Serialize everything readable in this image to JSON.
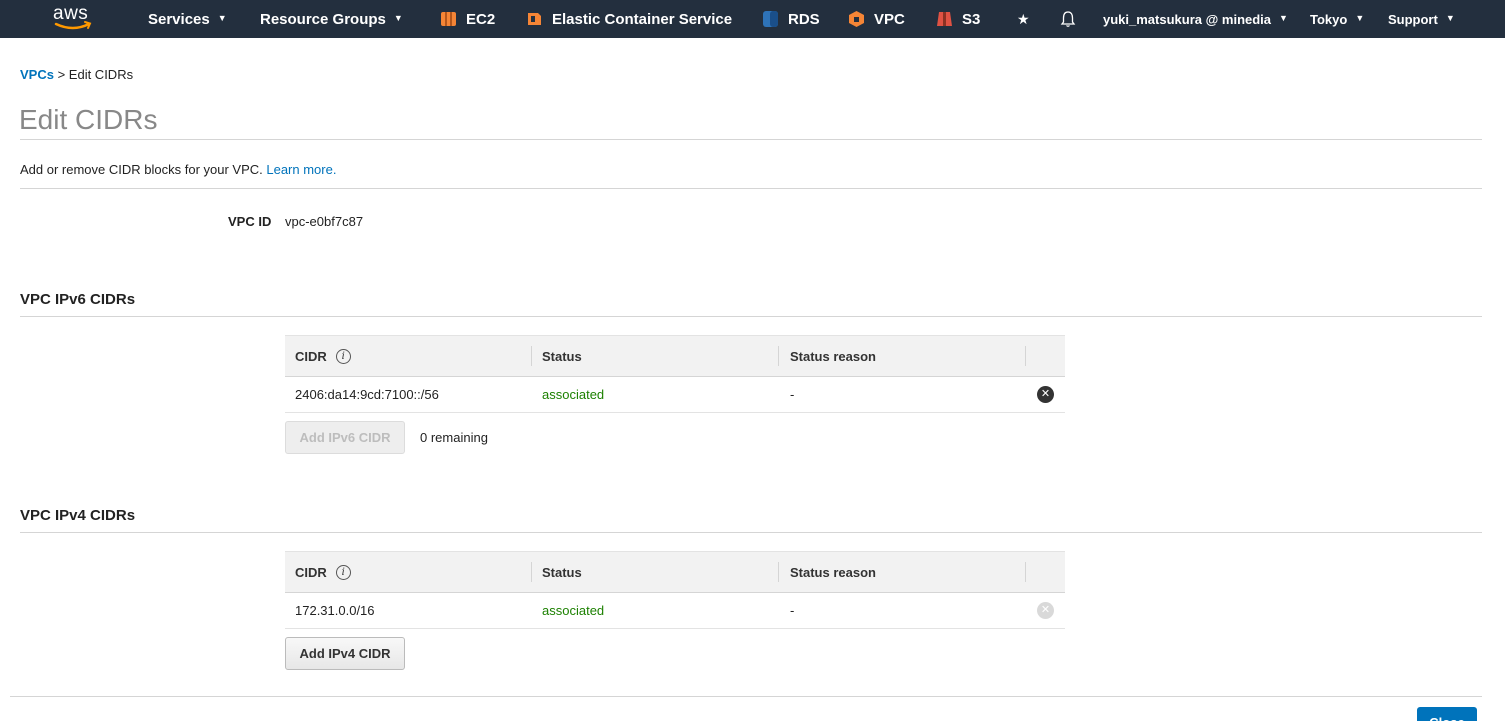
{
  "nav": {
    "logo_text": "aws",
    "services": "Services",
    "resource_groups": "Resource Groups",
    "shortcuts": [
      "EC2",
      "Elastic Container Service",
      "RDS",
      "VPC",
      "S3"
    ],
    "account": "yuki_matsukura @ minedia",
    "region": "Tokyo",
    "support": "Support",
    "colors": {
      "bar": "#232f3e",
      "ec2": "#f58536",
      "ecs": "#f58536",
      "rds": "#2e73b8",
      "vpc": "#f58536",
      "s3": "#e05243"
    }
  },
  "breadcrumb": {
    "parent": "VPCs",
    "separator": " > ",
    "current": "Edit CIDRs"
  },
  "page": {
    "title": "Edit CIDRs",
    "description": "Add or remove CIDR blocks for your VPC. ",
    "learn_more": "Learn more."
  },
  "vpc": {
    "label": "VPC ID",
    "value": "vpc-e0bf7c87"
  },
  "ipv6": {
    "title": "VPC IPv6 CIDRs",
    "headers": {
      "cidr": "CIDR",
      "status": "Status",
      "reason": "Status reason"
    },
    "rows": [
      {
        "cidr": "2406:da14:9cd:7100::/56",
        "status": "associated",
        "reason": "-"
      }
    ],
    "add_button": "Add IPv6 CIDR",
    "remaining": "0 remaining"
  },
  "ipv4": {
    "title": "VPC IPv4 CIDRs",
    "headers": {
      "cidr": "CIDR",
      "status": "Status",
      "reason": "Status reason"
    },
    "rows": [
      {
        "cidr": "172.31.0.0/16",
        "status": "associated",
        "reason": "-"
      }
    ],
    "add_button": "Add IPv4 CIDR"
  },
  "footer": {
    "close_button": "Close"
  }
}
